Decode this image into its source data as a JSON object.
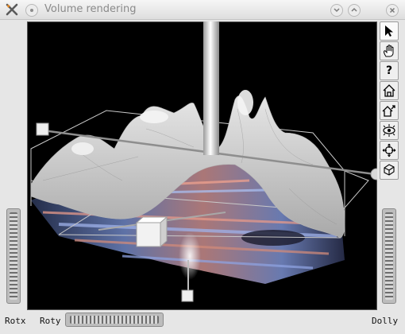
{
  "window": {
    "title": "Volume rendering"
  },
  "toolbar": {
    "buttons": [
      {
        "name": "select-arrow-icon"
      },
      {
        "name": "view-hand-icon"
      },
      {
        "name": "help-icon",
        "glyph": "?"
      },
      {
        "name": "home-icon"
      },
      {
        "name": "set-home-icon"
      },
      {
        "name": "view-all-icon"
      },
      {
        "name": "seek-icon"
      },
      {
        "name": "projection-cube-icon"
      }
    ]
  },
  "controls": {
    "rotx_label": "Rotx",
    "roty_label": "Roty",
    "dolly_label": "Dolly"
  }
}
